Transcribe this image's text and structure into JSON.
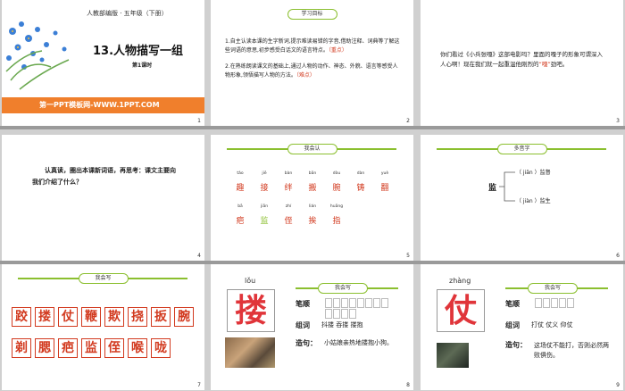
{
  "slide1": {
    "header": "人教部编版 · 五年级（下册）",
    "title": "13.人物描写一组",
    "subtitle": "第1课时",
    "banner": "第一PPT模板网-WWW.1PPT.COM",
    "number": "1"
  },
  "slide2": {
    "pill": "学习目标",
    "line1a": "1.自主认读本课的生字新词,提示难读易错的字音,借助注释、词典等了解这些词语的意思,初步感受白话文的语言特点。",
    "line1b": "（重点）",
    "line2a": "2.在熟练朗读课文的基础上,通过人物的动作、神态、外貌、语言等感受人物形象,领悟描写人物的方法。",
    "line2b": "（难点）",
    "number": "2"
  },
  "slide3": {
    "text_a": "你们看过《小兵张嘎》这部电影吗？里面的嘎子的形象可谓深入人心啊！现在我们就一起重温他刚烈的",
    "text_b": "“嘎”",
    "text_c": "劲吧。",
    "number": "3"
  },
  "slide4": {
    "text": "认真读，圈出本课新词语，再思考：课文主要向我们介绍了什么？",
    "number": "4"
  },
  "slide5": {
    "pill": "我会认",
    "row1": [
      {
        "py": "tǎo",
        "ch": "趣"
      },
      {
        "py": "jiē",
        "ch": "接"
      },
      {
        "py": "bàn",
        "ch": "绊"
      },
      {
        "py": "bān",
        "ch": "搬"
      },
      {
        "py": "dòu",
        "ch": "腕"
      },
      {
        "py": "dàn",
        "ch": "铸"
      },
      {
        "py": "yuè",
        "ch": "翻"
      }
    ],
    "row2": [
      {
        "py": "bā",
        "ch": "疤"
      },
      {
        "py": "jiān",
        "ch": "监"
      },
      {
        "py": "zhí",
        "ch": "侄"
      },
      {
        "py": "lián",
        "ch": "挨"
      },
      {
        "py": "huāng",
        "ch": "指"
      }
    ],
    "number": "5"
  },
  "slide6": {
    "pill": "多音字",
    "char": "监",
    "r1_py": "（ jiān ）",
    "r1_word": "监督",
    "r2_py": "（ jiàn ）",
    "r2_word": "监生",
    "number": "6"
  },
  "slide7": {
    "pill": "我会写",
    "row1": [
      "跤",
      "搂",
      "仗",
      "鞭",
      "欺",
      "挠",
      "扳",
      "腕"
    ],
    "row2": [
      "剃",
      "腮",
      "疤",
      "监",
      "侄",
      "喉",
      "咙"
    ],
    "number": "7"
  },
  "slide8": {
    "pill": "我会写",
    "pinyin": "lǒu",
    "char": "搂",
    "label_strokes": "笔顺",
    "label_words": "组词",
    "words": "抖搂  吞搂  搂抱",
    "label_sentence": "造句：",
    "sentence": "小姑娘亲热地搂抱小狗。",
    "number": "8"
  },
  "slide9": {
    "pill": "我会写",
    "pinyin": "zhàng",
    "char": "仗",
    "label_strokes": "笔顺",
    "label_words": "组词",
    "words": "打仗  仗义  仰仗",
    "label_sentence": "造句：",
    "sentence": "这场仗不能打，否则必然两败俱伤。",
    "number": "9"
  }
}
